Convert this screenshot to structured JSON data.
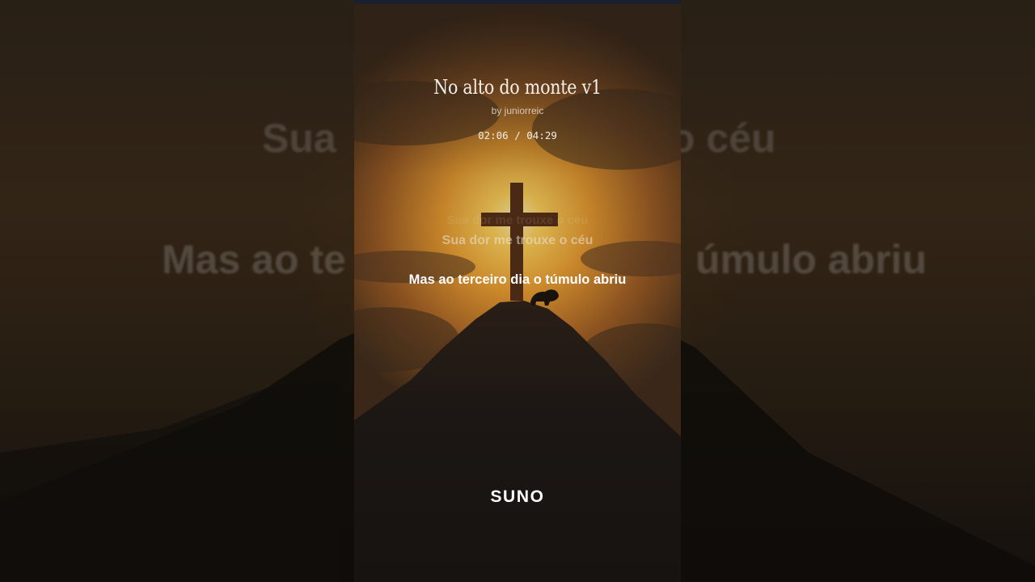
{
  "player": {
    "title": "No alto do monte v1",
    "artist": "by juniorreic",
    "time": "02:06 / 04:29"
  },
  "lyrics": {
    "previous2": "Sua dor me trouxe o céu",
    "previous": "Sua dor me trouxe o céu",
    "current": "Mas ao terceiro dia o túmulo abriu"
  },
  "background_lyrics": {
    "line1_left": "Sua",
    "line1_right": "o céu",
    "line2_left": "Mas ao te",
    "line2_right": "úmulo abriu"
  },
  "brand": {
    "name": "SUNO"
  },
  "colors": {
    "sky": "#c98a2c",
    "sun": "#ffd25a",
    "mountain": "#1c1714",
    "text": "#ffffff"
  }
}
